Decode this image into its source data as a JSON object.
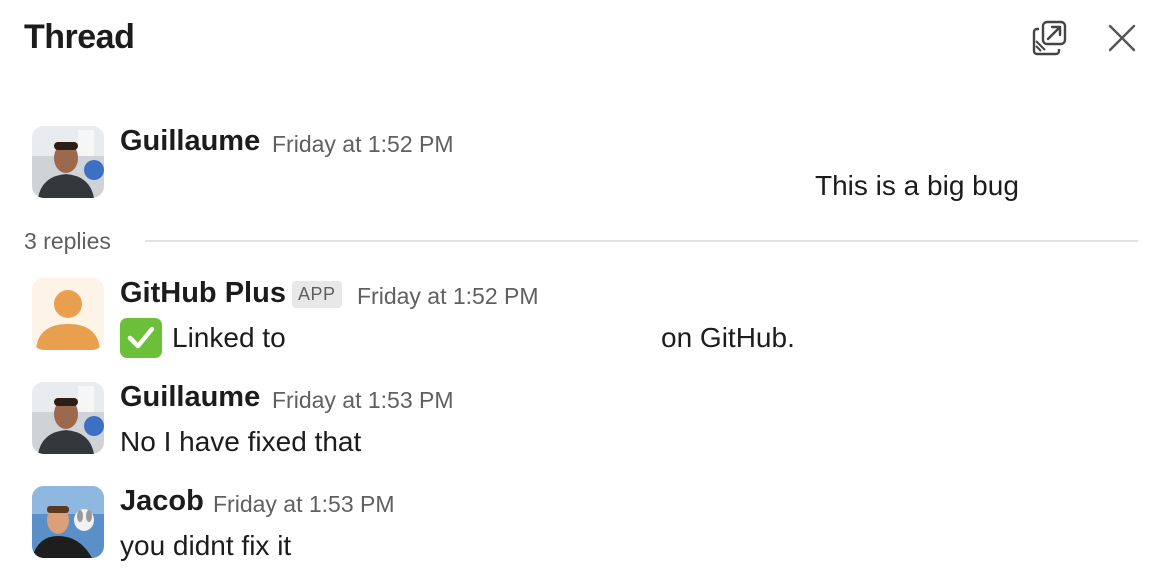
{
  "header": {
    "title": "Thread"
  },
  "parent": {
    "author": "Guillaume",
    "timestamp": "Friday at 1:52 PM",
    "text": "This is a big bug"
  },
  "replies": {
    "count_label": "3 replies",
    "items": [
      {
        "author": "GitHub Plus",
        "badge": "APP",
        "timestamp": "Friday at 1:52 PM",
        "emoji": "check-mark-icon",
        "text_prefix": "Linked to",
        "text_suffix": "on GitHub."
      },
      {
        "author": "Guillaume",
        "timestamp": "Friday at 1:53 PM",
        "text": "No I have fixed that"
      },
      {
        "author": "Jacob",
        "timestamp": "Friday at 1:53 PM",
        "text": "you didnt fix it"
      }
    ]
  },
  "colors": {
    "text_primary": "#1d1c1d",
    "text_secondary": "#616061",
    "divider": "#e2e2e2",
    "app_avatar_bg": "#fdf3e7",
    "app_avatar_fg": "#e8a04f",
    "check_bg": "#6cbf38"
  }
}
